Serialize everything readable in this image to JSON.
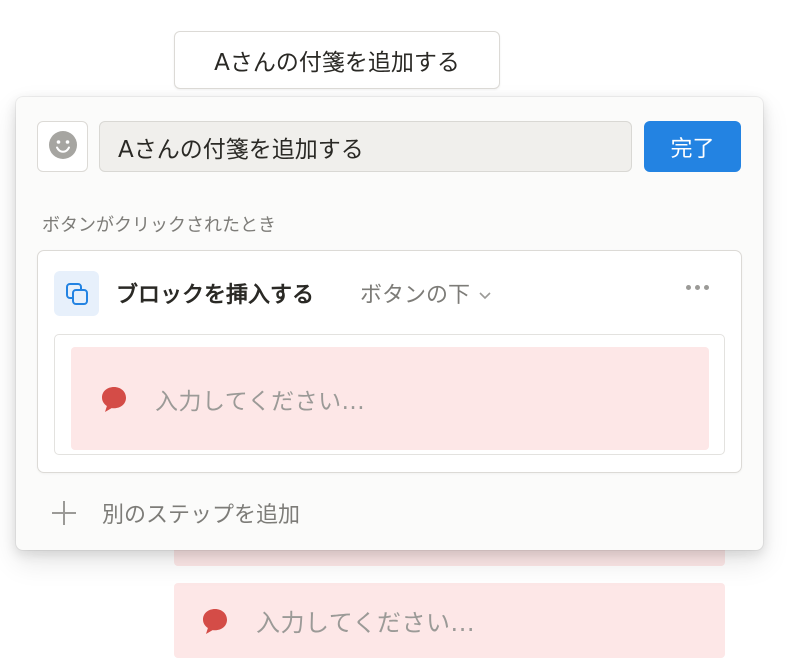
{
  "page_button": {
    "label": "Aさんの付箋を追加する"
  },
  "editor": {
    "emoji_icon": "smiley-face-icon",
    "title_value": "Aさんの付箋を追加する",
    "done_label": "完了",
    "section_label": "ボタンがクリックされたとき",
    "step": {
      "icon": "duplicate-block-icon",
      "action": "ブロックを挿入する",
      "position": "ボタンの下",
      "callout_icon": "speech-bubble-icon",
      "callout_placeholder": "入力してください..."
    },
    "add_step_label": "別のステップを追加"
  },
  "background": {
    "callout_placeholder": "入力してください..."
  },
  "colors": {
    "accent": "#2383e2",
    "callout_bg": "#fde7e7",
    "bubble": "#d44c47",
    "icon_bg": "#e7f0fb"
  }
}
